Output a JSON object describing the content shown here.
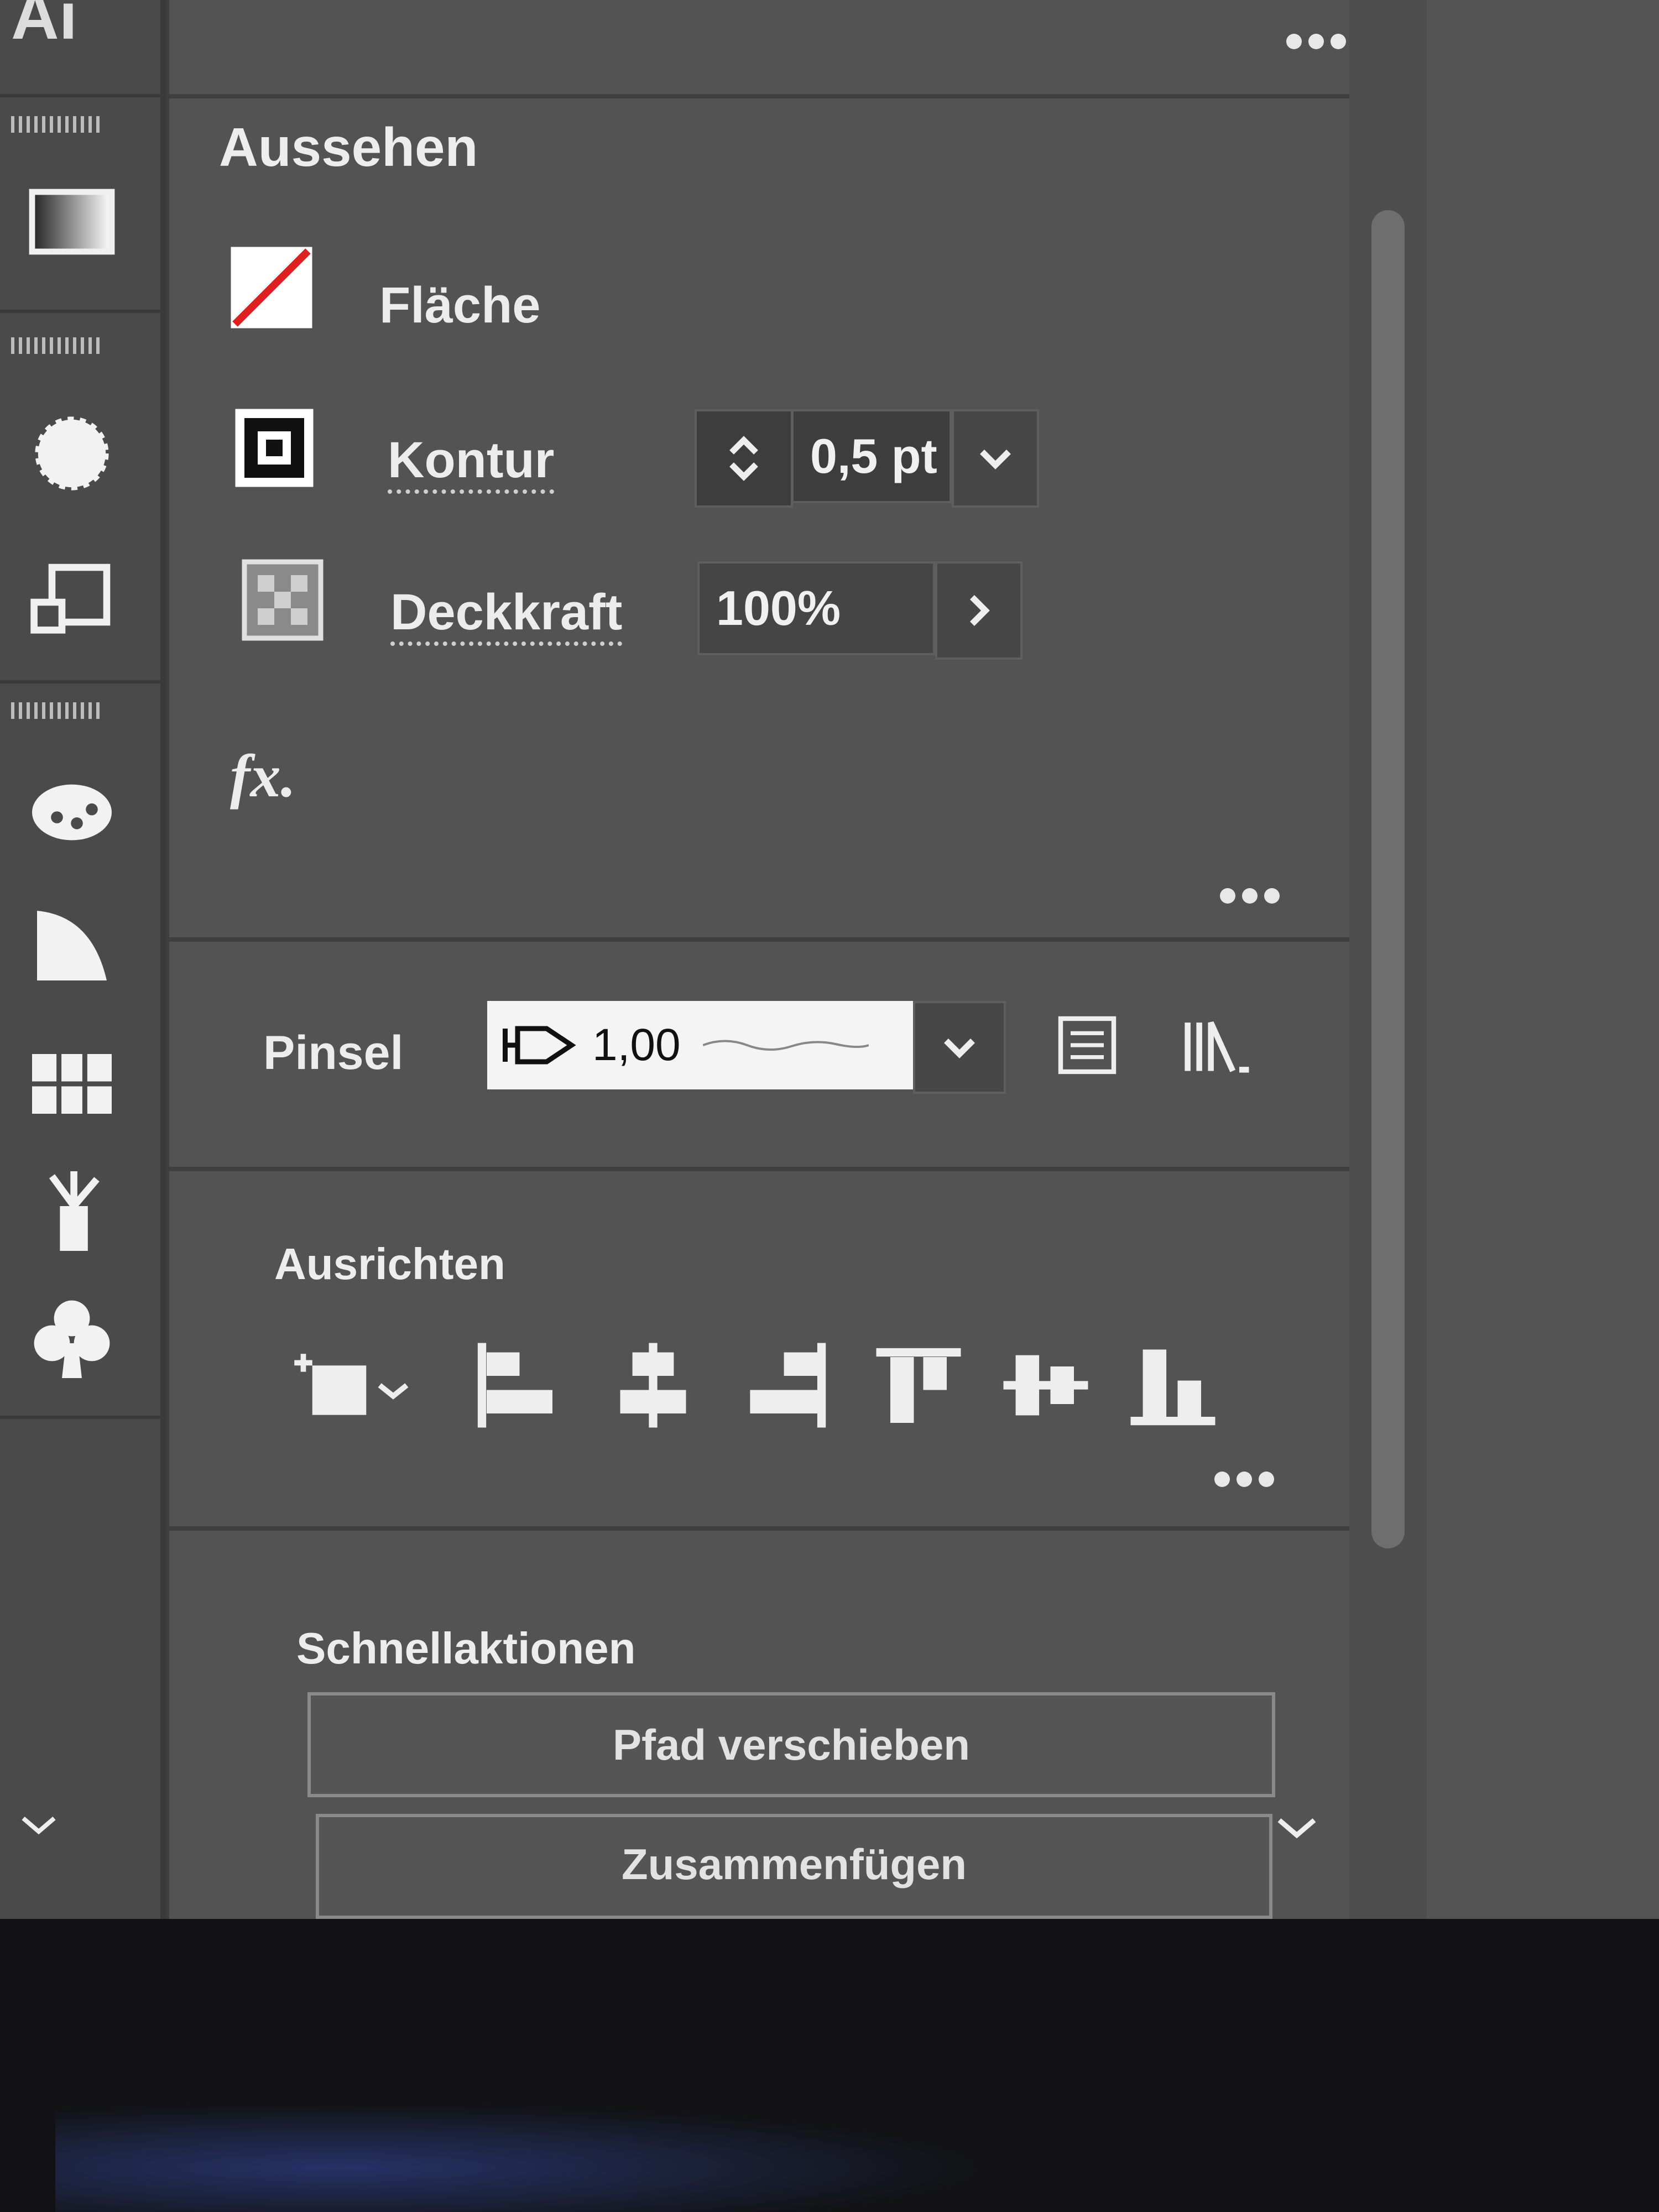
{
  "app": {
    "logo_text": "Ai"
  },
  "toolbar": {
    "tools": [
      {
        "name": "gradient-tool-icon"
      },
      {
        "name": "lasso-tool-icon"
      },
      {
        "name": "scale-tool-icon"
      },
      {
        "name": "live-paint-bucket-icon"
      },
      {
        "name": "perspective-grid-icon"
      },
      {
        "name": "mesh-tool-icon"
      },
      {
        "name": "symbol-sprayer-icon"
      },
      {
        "name": "symbol-club-icon"
      }
    ]
  },
  "appearance": {
    "title": "Aussehen",
    "fill_label": "Fläche",
    "stroke_label": "Kontur",
    "stroke_weight": "0,5 pt",
    "opacity_label": "Deckkraft",
    "opacity_value": "100%",
    "fx_label": "fx."
  },
  "brush": {
    "label": "Pinsel",
    "value": "1,00"
  },
  "align": {
    "title": "Ausrichten",
    "buttons": [
      {
        "name": "align-to-selection-dropdown-icon"
      },
      {
        "name": "align-left-icon"
      },
      {
        "name": "align-horizontal-center-icon"
      },
      {
        "name": "align-right-icon"
      },
      {
        "name": "align-top-icon"
      },
      {
        "name": "align-vertical-center-icon"
      },
      {
        "name": "align-bottom-icon"
      }
    ]
  },
  "quick_actions": {
    "title": "Schnellaktionen",
    "offset_path": "Pfad verschieben",
    "unite": "Zusammenfügen"
  },
  "colors": {
    "panel_bg": "#535353",
    "toolbar_bg": "#4a4a4a",
    "no_fill_red": "#e02020"
  }
}
